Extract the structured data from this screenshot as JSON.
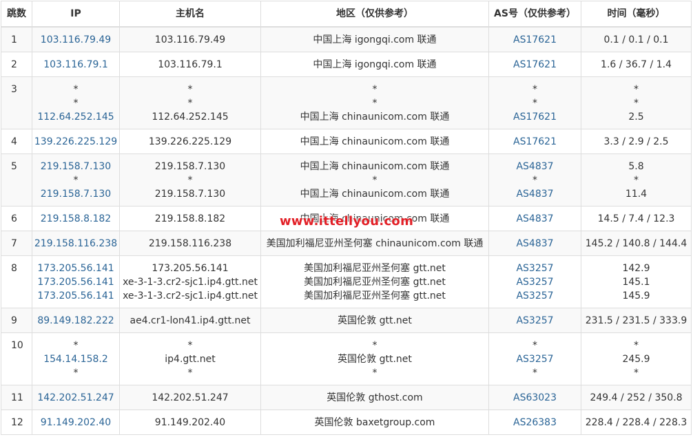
{
  "headers": {
    "hop": "跳数",
    "ip": "IP",
    "host": "主机名",
    "region": "地区（仅供参考）",
    "as": "AS号（仅供参考）",
    "time": "时间（毫秒）"
  },
  "rows": [
    {
      "hop": "1",
      "ip": [
        "103.116.79.49"
      ],
      "host": [
        "103.116.79.49"
      ],
      "region": [
        "中国上海 igongqi.com 联通"
      ],
      "as": [
        "AS17621"
      ],
      "time": [
        "0.1 / 0.1 / 0.1"
      ]
    },
    {
      "hop": "2",
      "ip": [
        "103.116.79.1"
      ],
      "host": [
        "103.116.79.1"
      ],
      "region": [
        "中国上海 igongqi.com 联通"
      ],
      "as": [
        "AS17621"
      ],
      "time": [
        "1.6 / 36.7 / 1.4"
      ]
    },
    {
      "hop": "3",
      "ip": [
        "*",
        "*",
        "112.64.252.145"
      ],
      "host": [
        "*",
        "*",
        "112.64.252.145"
      ],
      "region": [
        "*",
        "*",
        "中国上海 chinaunicom.com 联通"
      ],
      "as": [
        "*",
        "*",
        "AS17621"
      ],
      "time": [
        "*",
        "*",
        "2.5"
      ]
    },
    {
      "hop": "4",
      "ip": [
        "139.226.225.129"
      ],
      "host": [
        "139.226.225.129"
      ],
      "region": [
        "中国上海 chinaunicom.com 联通"
      ],
      "as": [
        "AS17621"
      ],
      "time": [
        "3.3 / 2.9 / 2.5"
      ]
    },
    {
      "hop": "5",
      "ip": [
        "219.158.7.130",
        "*",
        "219.158.7.130"
      ],
      "host": [
        "219.158.7.130",
        "*",
        "219.158.7.130"
      ],
      "region": [
        "中国上海 chinaunicom.com 联通",
        "*",
        "中国上海 chinaunicom.com 联通"
      ],
      "as": [
        "AS4837",
        "*",
        "AS4837"
      ],
      "time": [
        "5.8",
        "*",
        "11.4"
      ]
    },
    {
      "hop": "6",
      "ip": [
        "219.158.8.182"
      ],
      "host": [
        "219.158.8.182"
      ],
      "region": [
        "中国上海 chinaunicom.com 联通"
      ],
      "as": [
        "AS4837"
      ],
      "time": [
        "14.5 / 7.4 / 12.3"
      ]
    },
    {
      "hop": "7",
      "ip": [
        "219.158.116.238"
      ],
      "host": [
        "219.158.116.238"
      ],
      "region": [
        "美国加利福尼亚州圣何塞 chinaunicom.com 联通"
      ],
      "as": [
        "AS4837"
      ],
      "time": [
        "145.2 / 140.8 / 144.4"
      ]
    },
    {
      "hop": "8",
      "ip": [
        "173.205.56.141",
        "173.205.56.141",
        "173.205.56.141"
      ],
      "host": [
        "173.205.56.141",
        "xe-3-1-3.cr2-sjc1.ip4.gtt.net",
        "xe-3-1-3.cr2-sjc1.ip4.gtt.net"
      ],
      "region": [
        "美国加利福尼亚州圣何塞 gtt.net",
        "美国加利福尼亚州圣何塞 gtt.net",
        "美国加利福尼亚州圣何塞 gtt.net"
      ],
      "as": [
        "AS3257",
        "AS3257",
        "AS3257"
      ],
      "time": [
        "142.9",
        "145.1",
        "145.9"
      ]
    },
    {
      "hop": "9",
      "ip": [
        "89.149.182.222"
      ],
      "host": [
        "ae4.cr1-lon41.ip4.gtt.net"
      ],
      "region": [
        "英国伦敦 gtt.net"
      ],
      "as": [
        "AS3257"
      ],
      "time": [
        "231.5 / 231.5 / 333.9"
      ]
    },
    {
      "hop": "10",
      "ip": [
        "*",
        "154.14.158.2",
        "*"
      ],
      "host": [
        "*",
        "ip4.gtt.net",
        "*"
      ],
      "region": [
        "*",
        "英国伦敦 gtt.net",
        "*"
      ],
      "as": [
        "*",
        "AS3257",
        "*"
      ],
      "time": [
        "*",
        "245.9",
        "*"
      ]
    },
    {
      "hop": "11",
      "ip": [
        "142.202.51.247"
      ],
      "host": [
        "142.202.51.247"
      ],
      "region": [
        "英国伦敦 gthost.com"
      ],
      "as": [
        "AS63023"
      ],
      "time": [
        "249.4 / 252 / 350.8"
      ]
    },
    {
      "hop": "12",
      "ip": [
        "91.149.202.40"
      ],
      "host": [
        "91.149.202.40"
      ],
      "region": [
        "英国伦敦 baxetgroup.com"
      ],
      "as": [
        "AS26383"
      ],
      "time": [
        "228.4 / 228.4 / 228.3"
      ]
    }
  ],
  "watermark": "www.ittellyou.com",
  "colors": {
    "link": "#2a6496",
    "watermark": "#e21f26",
    "stripe": "#f9f9f9",
    "border": "#dddddd"
  }
}
